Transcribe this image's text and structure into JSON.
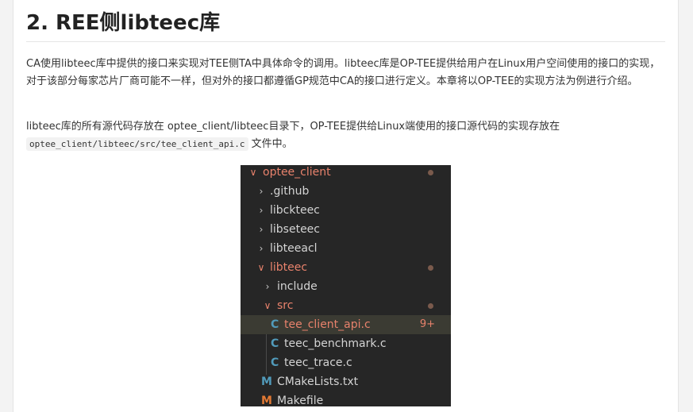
{
  "heading": "2. REE侧libteec库",
  "paragraph1": "CA使用libteec库中提供的接口来实现对TEE侧TA中具体命令的调用。libteec库是OP-TEE提供给用户在Linux用户空间使用的接口的实现，对于该部分每家芯片厂商可能不一样，但对外的接口都遵循GP规范中CA的接口进行定义。本章将以OP-TEE的实现方法为例进行介绍。",
  "paragraph2": {
    "text_before": "libteec库的所有源代码存放在 optee_client/libteec目录下，OP-TEE提供给Linux端使用的接口源代码的实现存放在",
    "code": "optee_client/libteec/src/tee_client_api.c",
    "text_after": " 文件中。"
  },
  "file_tree": {
    "root": "optee_client",
    "items": {
      "github": ".github",
      "libckteec": "libckteec",
      "libseteec": "libseteec",
      "libteeacl": "libteeacl",
      "libteec": "libteec",
      "include": "include",
      "src": "src",
      "tee_client_api": "tee_client_api.c",
      "tee_client_api_badge": "9+",
      "teec_benchmark": "teec_benchmark.c",
      "teec_trace": "teec_trace.c",
      "cmakelists": "CMakeLists.txt",
      "makefile": "Makefile"
    },
    "icons": {
      "c_file": "C",
      "cmake_file": "M",
      "makefile": "M"
    },
    "colors": {
      "background": "#262626",
      "modified": "#e8826c",
      "c_icon": "#519aba",
      "makefile_icon": "#e37933"
    }
  }
}
